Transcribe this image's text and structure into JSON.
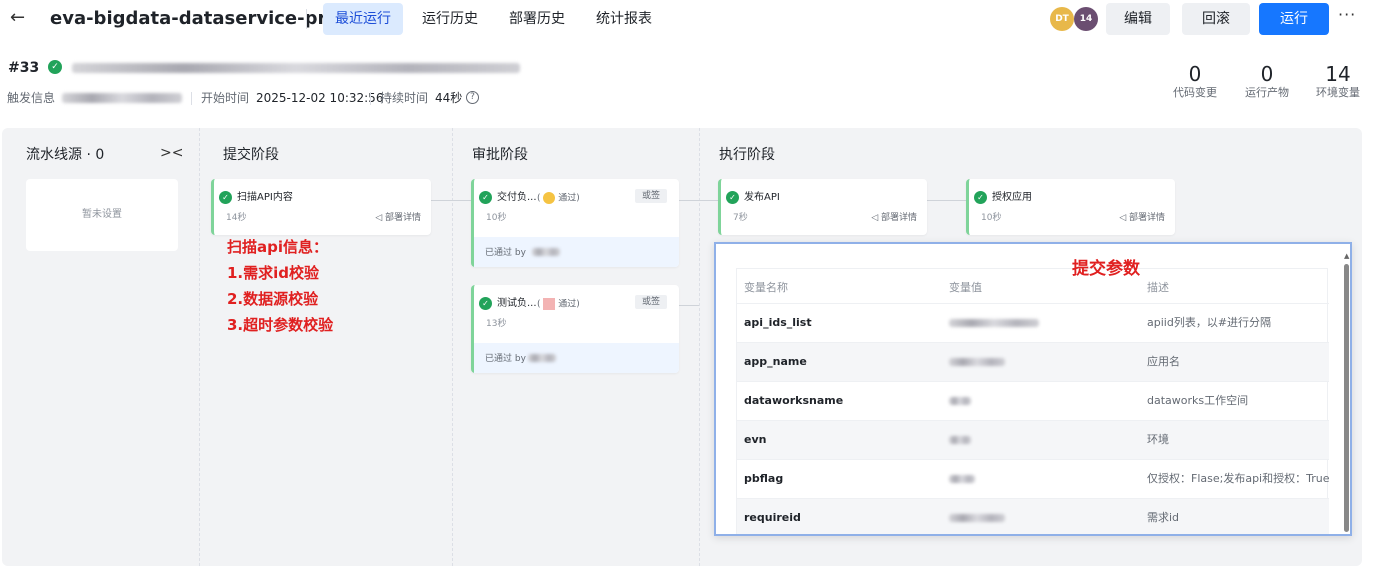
{
  "header": {
    "back_icon": "arrow-left-icon",
    "title": "eva-bigdata-dataservice-prod",
    "tabs": [
      {
        "label": "最近运行",
        "active": true
      },
      {
        "label": "运行历史",
        "active": false
      },
      {
        "label": "部署历史",
        "active": false
      },
      {
        "label": "统计报表",
        "active": false
      }
    ],
    "avatars": [
      {
        "text": "DT",
        "color": "#e8b84a"
      },
      {
        "text": "14",
        "color": "#6b4e71"
      }
    ],
    "edit_label": "编辑",
    "rollback_label": "回滚",
    "run_label": "运行",
    "more_label": "···"
  },
  "run": {
    "number": "#33",
    "trigger_label": "触发信息",
    "start_label": "开始时间",
    "start_time": "2025-12-02 10:32:56",
    "duration_label": "持续时间",
    "duration": "44秒",
    "stats": [
      {
        "value": "0",
        "label": "代码变更"
      },
      {
        "value": "0",
        "label": "运行产物"
      },
      {
        "value": "14",
        "label": "环境变量"
      }
    ]
  },
  "pipeline": {
    "source": {
      "title": "流水线源 · 0",
      "empty": "暂未设置",
      "collapse_icon": "collapse-icon"
    },
    "stages": [
      {
        "title": "提交阶段"
      },
      {
        "title": "审批阶段"
      },
      {
        "title": "执行阶段"
      }
    ],
    "cards": {
      "scan": {
        "name": "扫描API内容",
        "duration": "14秒",
        "link": "部署详情"
      },
      "deliver": {
        "name": "交付负...",
        "pass": "通过)",
        "tag": "或签",
        "duration": "10秒",
        "footer": "已通过 by"
      },
      "test": {
        "name": "测试负...",
        "pass": "通过)",
        "tag": "或签",
        "duration": "13秒",
        "footer": "已通过 by"
      },
      "publish": {
        "name": "发布API",
        "duration": "7秒",
        "link": "部署详情"
      },
      "authorize": {
        "name": "授权应用",
        "duration": "10秒",
        "link": "部署详情"
      }
    }
  },
  "annotation": {
    "lines": [
      "扫描api信息：",
      "1.需求id校验",
      "2.数据源校验",
      "3.超时参数校验"
    ]
  },
  "params_panel": {
    "title": "提交参数",
    "headers": [
      "变量名称",
      "变量值",
      "描述"
    ],
    "rows": [
      {
        "name": "api_ids_list",
        "desc": "apiid列表，以#进行分隔"
      },
      {
        "name": "app_name",
        "desc": "应用名"
      },
      {
        "name": "dataworksname",
        "desc": "dataworks工作空间"
      },
      {
        "name": "evn",
        "desc": "环境"
      },
      {
        "name": "pbflag",
        "desc": "仅授权：Flase;发布api和授权：True"
      },
      {
        "name": "requireid",
        "desc": "需求id"
      }
    ]
  }
}
